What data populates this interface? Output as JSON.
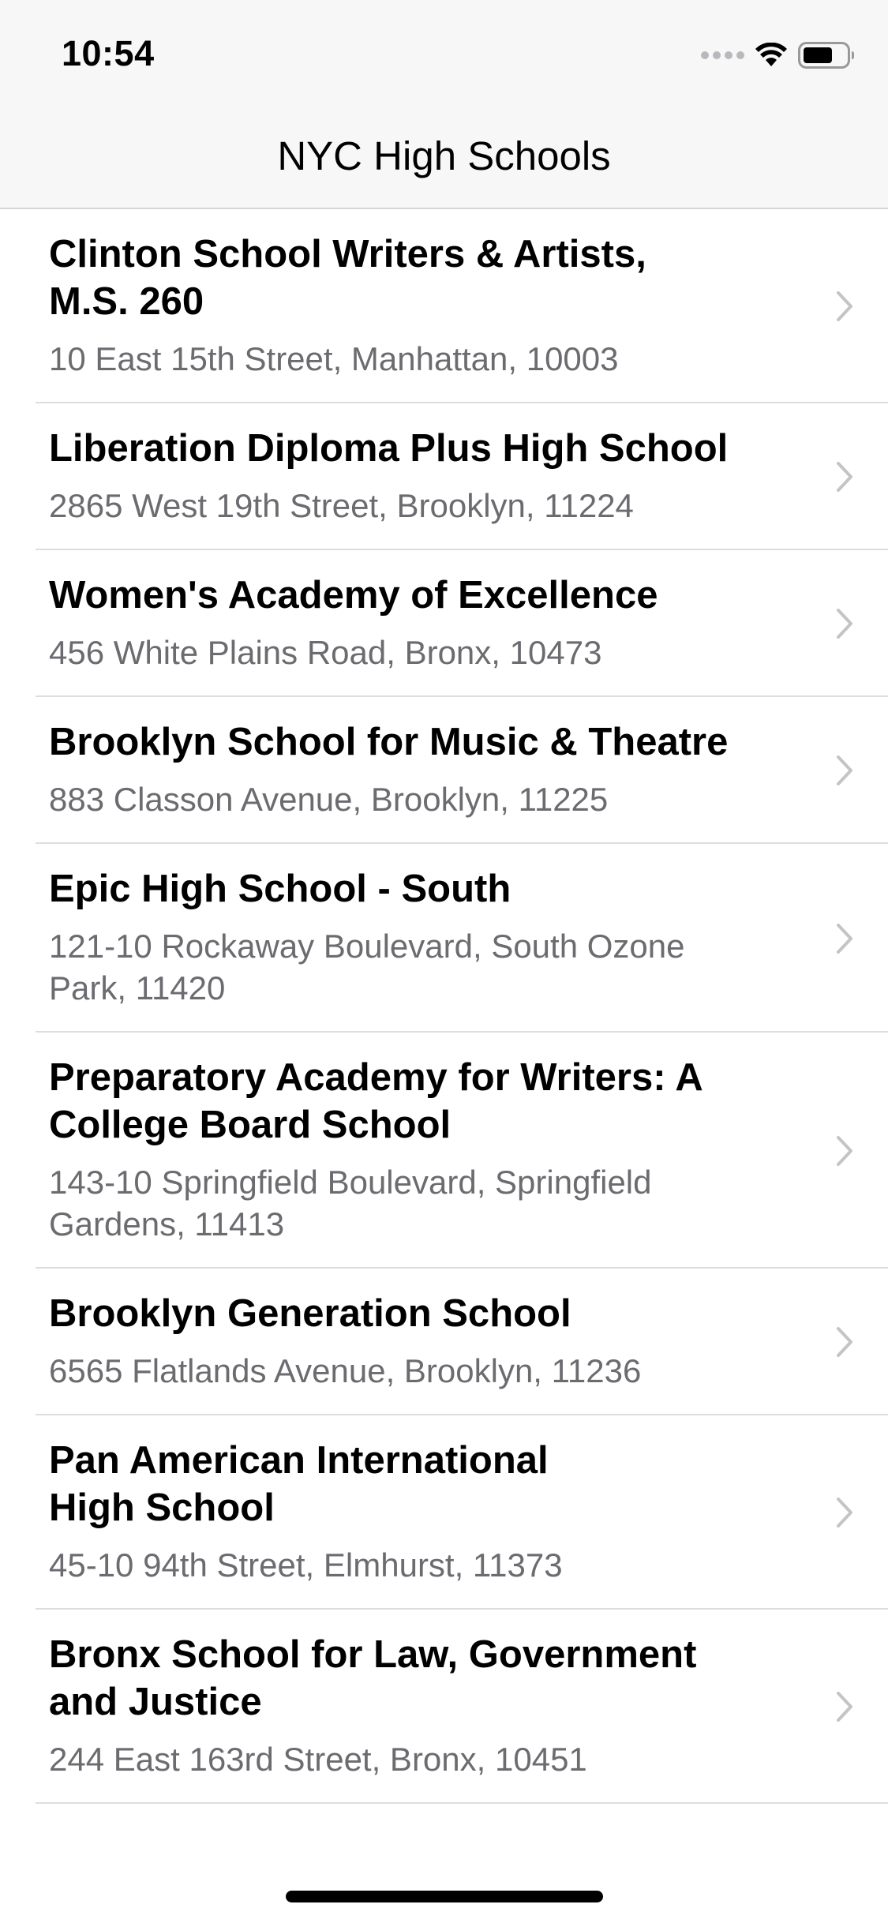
{
  "status_bar": {
    "time": "10:54"
  },
  "nav": {
    "title": "NYC High Schools"
  },
  "schools": [
    {
      "name": "Clinton School Writers & Artists,\nM.S. 260",
      "address": "10 East 15th Street, Manhattan, 10003"
    },
    {
      "name": "Liberation Diploma Plus High School",
      "address": "2865 West 19th Street, Brooklyn, 11224"
    },
    {
      "name": "Women's Academy of Excellence",
      "address": "456 White Plains Road, Bronx, 10473"
    },
    {
      "name": "Brooklyn School for Music & Theatre",
      "address": "883 Classon Avenue, Brooklyn, 11225"
    },
    {
      "name": "Epic High School - South",
      "address": "121-10 Rockaway Boulevard, South Ozone\nPark, 11420"
    },
    {
      "name": "Preparatory Academy for Writers: A\nCollege Board School",
      "address": "143-10 Springfield Boulevard, Springfield\nGardens, 11413"
    },
    {
      "name": "Brooklyn Generation School",
      "address": "6565 Flatlands Avenue, Brooklyn, 11236"
    },
    {
      "name": "Pan American International\nHigh School",
      "address": "45-10 94th Street, Elmhurst, 11373"
    },
    {
      "name": "Bronx School for Law, Government\nand Justice",
      "address": "244 East 163rd Street, Bronx, 10451"
    }
  ],
  "icons": {
    "row_accessory": "chevron-right-icon",
    "wifi": "wifi-icon",
    "battery": "battery-icon",
    "signal": "cellular-signal-icon"
  },
  "colors": {
    "nav_background": "#f7f7f7",
    "subtitle_text": "#6b6b70",
    "separator": "#dedee1",
    "chevron": "#c4c4c7"
  }
}
